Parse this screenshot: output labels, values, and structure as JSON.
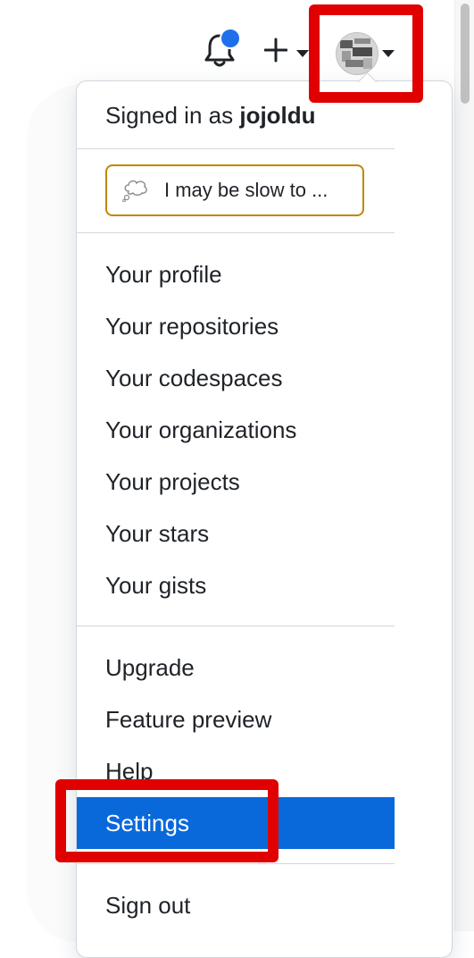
{
  "header": {
    "notifications_icon": "bell-icon",
    "create_icon": "plus-icon",
    "avatar_alt": "user-avatar"
  },
  "menu": {
    "signed_in_prefix": "Signed in as",
    "username": "jojoldu",
    "status_text": "I may be slow to ...",
    "status_icon": "thought-bubble-icon",
    "group1": [
      {
        "label": "Your profile"
      },
      {
        "label": "Your repositories"
      },
      {
        "label": "Your codespaces"
      },
      {
        "label": "Your organizations"
      },
      {
        "label": "Your projects"
      },
      {
        "label": "Your stars"
      },
      {
        "label": "Your gists"
      }
    ],
    "group2": [
      {
        "label": "Upgrade"
      },
      {
        "label": "Feature preview"
      },
      {
        "label": "Help"
      },
      {
        "label": "Settings"
      }
    ],
    "sign_out": "Sign out"
  },
  "colors": {
    "active": "#0969da",
    "highlight": "#e00000",
    "status_border": "#bf8700",
    "notification_dot": "#1f6feb"
  }
}
